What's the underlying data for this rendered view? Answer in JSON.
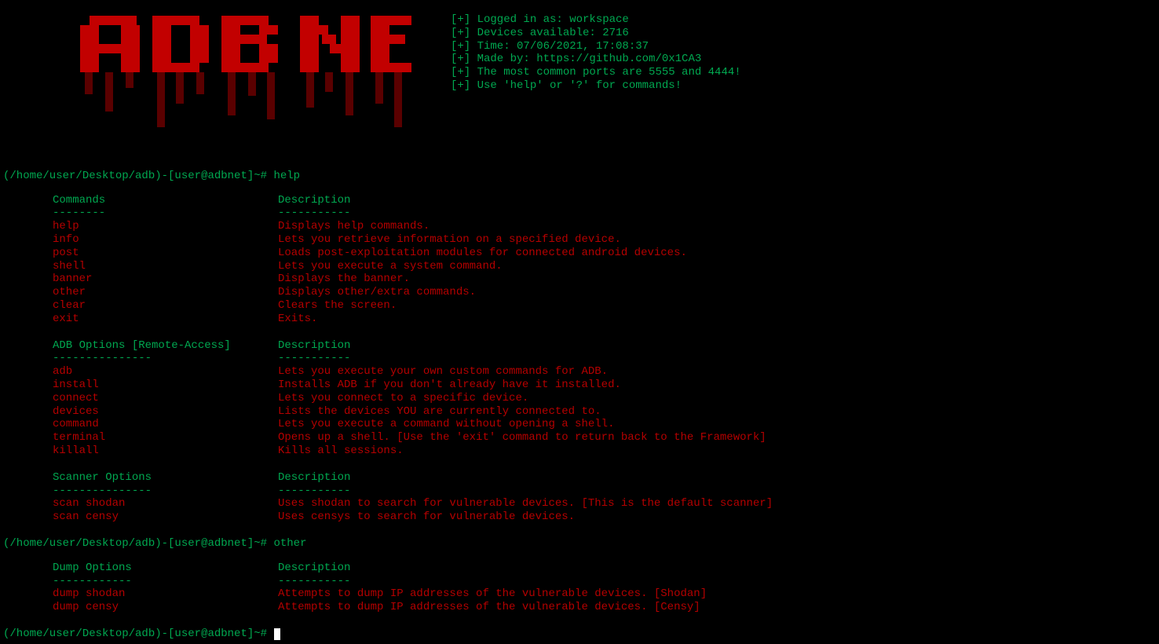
{
  "info": {
    "loggedIn": "[+] Logged in as: workspace",
    "devices": "[+] Devices available: 2716",
    "time": "[+] Time: 07/06/2021, 17:08:37",
    "madeBy": "[+] Made by: https://github.com/0x1CA3",
    "ports": "[+] The most common ports are 5555 and 4444!",
    "helpHint": "[+] Use 'help' or '?' for commands!"
  },
  "prompts": {
    "p1path": "(/home/user/Desktop/adb)-[user@adbnet]~# ",
    "p1cmd": "help",
    "p2path": "(/home/user/Desktop/adb)-[user@adbnet]~# ",
    "p2cmd": "other",
    "p3path": "(/home/user/Desktop/adb)-[user@adbnet]~# "
  },
  "sections": {
    "commands": {
      "header1": "Commands",
      "header2": "Description",
      "dash1": "--------",
      "dash2": "-----------",
      "rows": [
        {
          "cmd": "help",
          "desc": "Displays help commands."
        },
        {
          "cmd": "info",
          "desc": "Lets you retrieve information on a specified device."
        },
        {
          "cmd": "post",
          "desc": "Loads post-exploitation modules for connected android devices."
        },
        {
          "cmd": "shell",
          "desc": "Lets you execute a system command."
        },
        {
          "cmd": "banner",
          "desc": "Displays the banner."
        },
        {
          "cmd": "other",
          "desc": "Displays other/extra commands."
        },
        {
          "cmd": "clear",
          "desc": "Clears the screen."
        },
        {
          "cmd": "exit",
          "desc": "Exits."
        }
      ]
    },
    "adb": {
      "header1": "ADB Options [Remote-Access]",
      "header2": "Description",
      "dash1": "---------------",
      "dash2": "-----------",
      "rows": [
        {
          "cmd": "adb",
          "desc": "Lets you execute your own custom commands for ADB."
        },
        {
          "cmd": "install",
          "desc": "Installs ADB if you don't already have it installed."
        },
        {
          "cmd": "connect",
          "desc": "Lets you connect to a specific device."
        },
        {
          "cmd": "devices",
          "desc": "Lists the devices YOU are currently connected to."
        },
        {
          "cmd": "command",
          "desc": "Lets you execute a command without opening a shell."
        },
        {
          "cmd": "terminal",
          "desc": "Opens up a shell. [Use the 'exit' command to return back to the Framework]"
        },
        {
          "cmd": "killall",
          "desc": "Kills all sessions."
        }
      ]
    },
    "scanner": {
      "header1": "Scanner Options",
      "header2": "Description",
      "dash1": "---------------",
      "dash2": "-----------",
      "rows": [
        {
          "cmd": "scan shodan",
          "desc": "Uses shodan to search for vulnerable devices. [This is the default scanner]"
        },
        {
          "cmd": "scan censy",
          "desc": "Uses censys to search for vulnerable devices."
        }
      ]
    },
    "dump": {
      "header1": "Dump Options",
      "header2": "Description",
      "dash1": "------------",
      "dash2": "-----------",
      "rows": [
        {
          "cmd": "dump shodan",
          "desc": "Attempts to dump IP addresses of the vulnerable devices. [Shodan]"
        },
        {
          "cmd": "dump censy",
          "desc": "Attempts to dump IP addresses of the vulnerable devices. [Censy]"
        }
      ]
    }
  }
}
